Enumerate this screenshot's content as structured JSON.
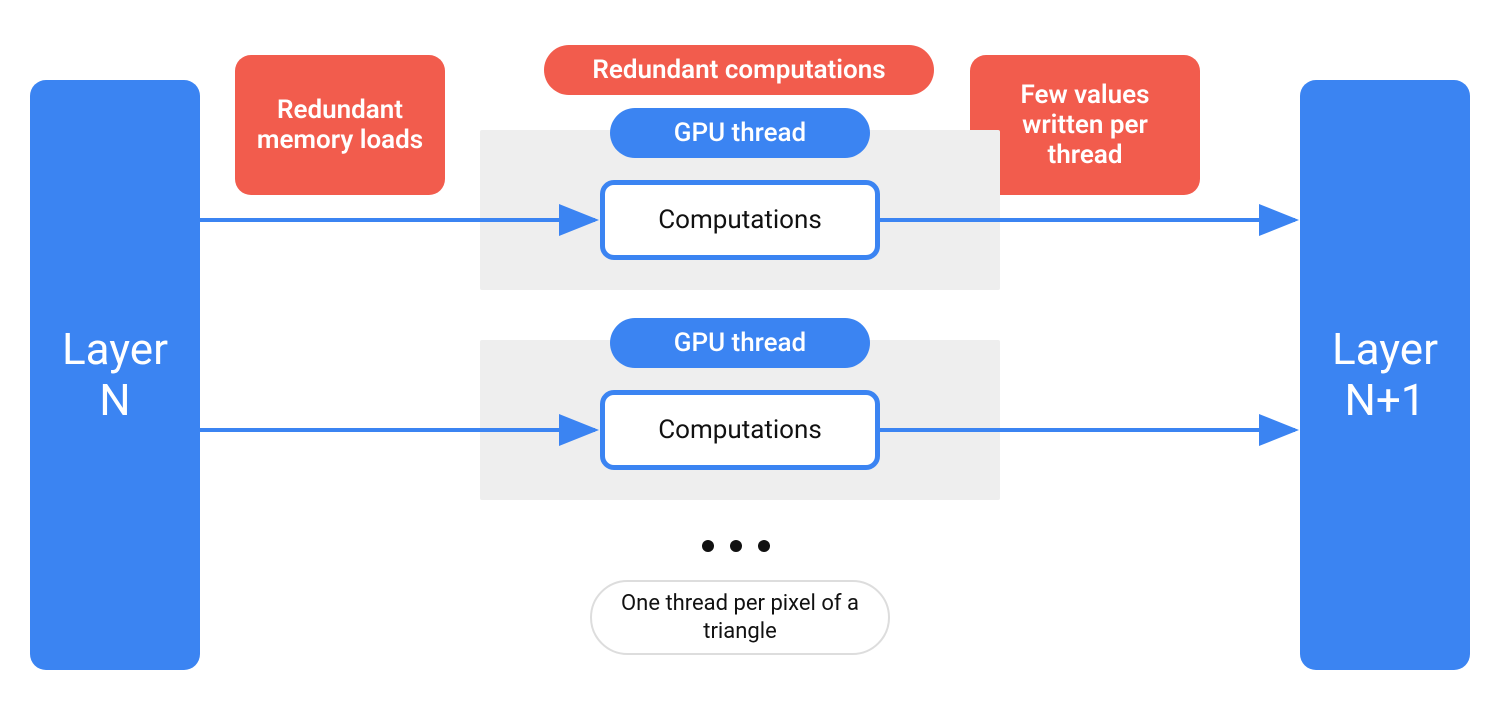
{
  "colors": {
    "blue": "#3b84f2",
    "red": "#f25c4d",
    "panel": "#eeeeee"
  },
  "layers": {
    "left": "Layer\nN",
    "right": "Layer\nN+1"
  },
  "callouts": {
    "redundant_memory": "Redundant memory loads",
    "redundant_comp": "Redundant computations",
    "few_values": "Few values written per thread"
  },
  "threads": [
    {
      "label": "GPU thread",
      "box": "Computations"
    },
    {
      "label": "GPU thread",
      "box": "Computations"
    }
  ],
  "footer_pill": "One thread per pixel of a triangle",
  "ellipsis": "• • •"
}
